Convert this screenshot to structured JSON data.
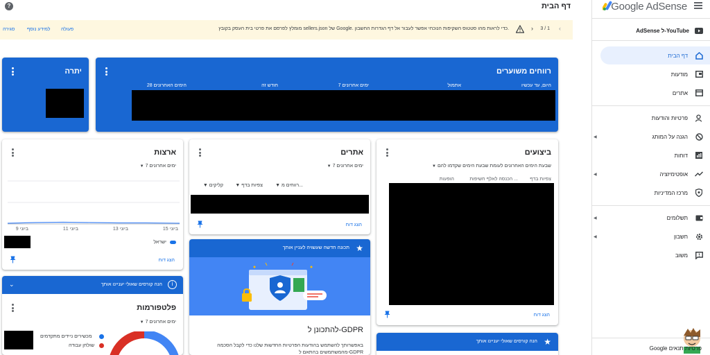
{
  "app": {
    "brand": "Google AdSense"
  },
  "topbar": {
    "page_title": "דף הבית",
    "help": "?"
  },
  "banner": {
    "message": "מומלץ לפרסם את פרטי בית העסק בקובץ sellers.json של Google. כדי לראות מהו סטטוס השקיפות הנוכחי אפשר לעבור אל דף הגדרות החשבון.",
    "pager": "3 / 1",
    "actions": [
      "פעולה",
      "למידע נוסף",
      "סגירה"
    ]
  },
  "sidebar": {
    "youtube": "AdSense ל-YouTube",
    "items": [
      {
        "label": "דף הבית",
        "icon": "home-icon",
        "active": true
      },
      {
        "label": "מודעות",
        "icon": "ads-icon"
      },
      {
        "label": "אתרים",
        "icon": "sites-icon"
      },
      {
        "label": "פרטיות והודעות",
        "icon": "privacy-icon"
      },
      {
        "label": "הגנה על המותג",
        "icon": "block-icon",
        "caret": true
      },
      {
        "label": "דוחות",
        "icon": "reports-icon"
      },
      {
        "label": "אופטימיזציה",
        "icon": "optimization-icon",
        "caret": true
      },
      {
        "label": "מרכז המדיניות",
        "icon": "policy-icon"
      },
      {
        "label": "תשלומים",
        "icon": "payments-icon",
        "caret": true
      },
      {
        "label": "חשבון",
        "icon": "account-icon",
        "caret": true
      },
      {
        "label": "משוב",
        "icon": "feedback-icon"
      }
    ],
    "footer": "Google פרטיות תנאים"
  },
  "estimated_earnings": {
    "title": "רווחים משוערים",
    "columns": [
      "היום, עד עכשיו",
      "אתמול",
      "7 ימים אחרונים",
      "חודש זה",
      "28 הימים האחרונים"
    ]
  },
  "balance": {
    "title": "יתרה"
  },
  "performance": {
    "title": "ביצועים",
    "range": "שבעת הימים האחרונים לעומת שבעת הימים שקדמו להם",
    "cols": [
      "צפיות בדף",
      "הכנסה לאלף חשיפות ...",
      "הופעות"
    ],
    "report_link": "הצג דוח"
  },
  "sites": {
    "title": "אתרים",
    "range": "7 ימים אחרונים",
    "cols": [
      "רווחים מ...",
      "צפיות בדף",
      "קליקים"
    ],
    "report_link": "הצג דוח"
  },
  "countries": {
    "title": "ארצות",
    "range": "7 ימים אחרונים",
    "x_ticks": [
      "15 ביוני",
      "13 ביוני",
      "11 ביוני",
      "9 ביוני"
    ],
    "legend": "ישראל",
    "report_link": "הצג דוח"
  },
  "feature_card": {
    "header": "תכונה חדשה שעשויה לעניין אותך",
    "title": "להתכונן ל-GDPR",
    "body": "באפשרותך להשתמש בהודעות הפרטיות החדשות שלנו כדי לקבל הסכמה מהמשתמשים בהתאם ל-GDPR"
  },
  "course_card_left": {
    "header": "הנה קורסים שאולי יעניינו אותך"
  },
  "course_card_bottom": {
    "header": "הנה קורסים שאולי יעניינו אותך"
  },
  "platforms": {
    "title": "פלטפורמות",
    "range": "7 ימים אחרונים",
    "legend": [
      "מכשירים ניידים מתקדמים",
      "שולחן עבודה"
    ]
  },
  "colors": {
    "primary_blue": "#1967d2",
    "banner_bg": "#fef7e0",
    "red": "#d93025",
    "light_blue": "#4285f4"
  }
}
